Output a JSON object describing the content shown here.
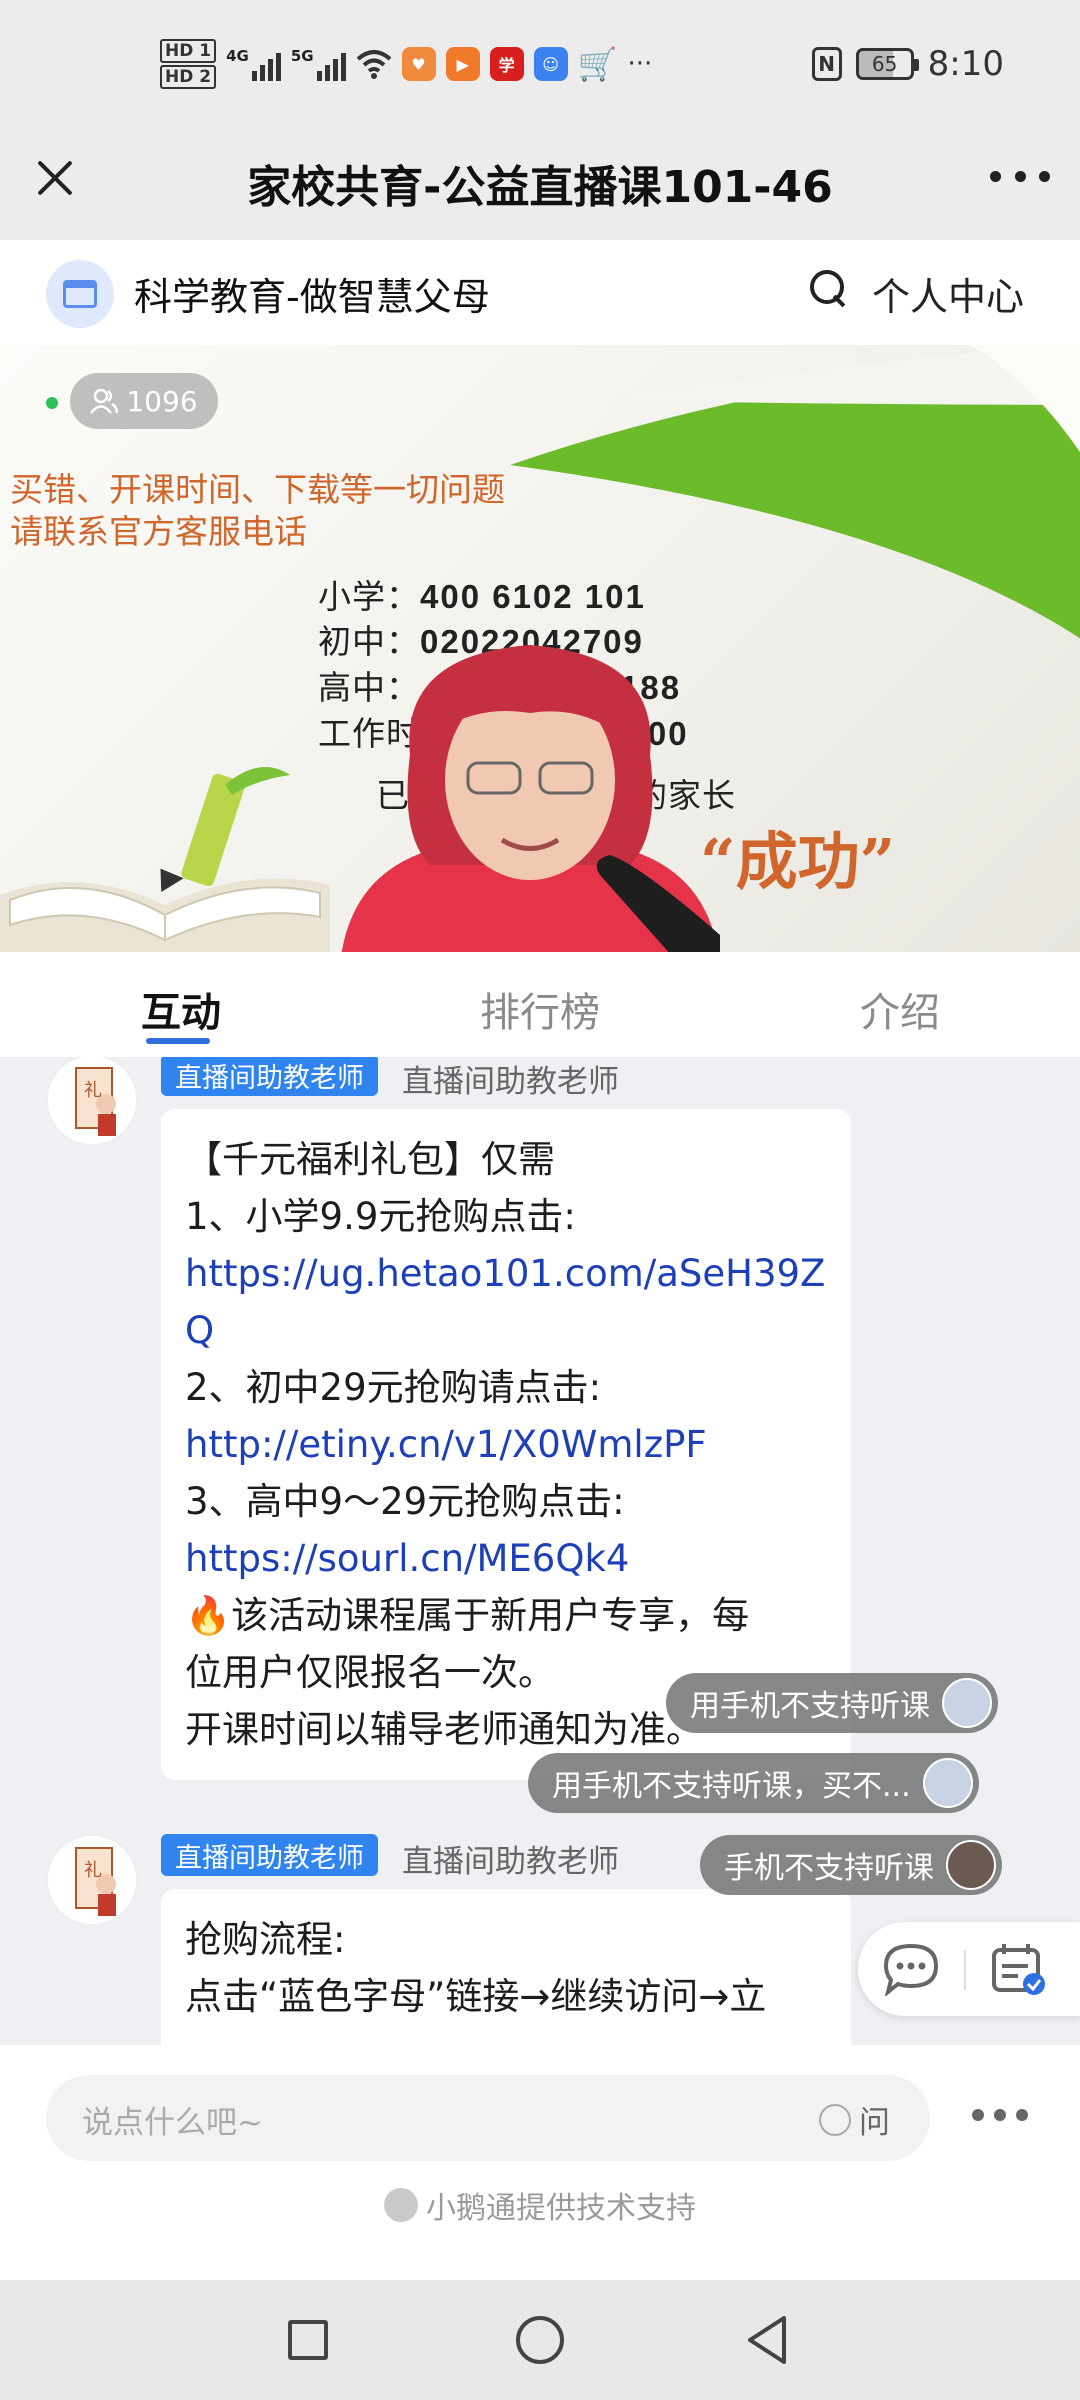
{
  "status_bar": {
    "hd1": "HD 1",
    "hd2": "HD 2",
    "net1": "4G",
    "net2": "5G",
    "more": "···",
    "nfc": "N",
    "battery": "65",
    "time": "8:10"
  },
  "titlebar": {
    "title": "家校共育-公益直播课101-46"
  },
  "shop": {
    "name": "科学教育-做智慧父母",
    "personal_center": "个人中心"
  },
  "video": {
    "viewers": "1096",
    "banner_line1": "买错、开课时间、下载等一切问题",
    "banner_line2": "请联系官方客服电话",
    "primary_label": "小学：",
    "primary_phone": "400 6102 101",
    "middle_label": "初中：",
    "middle_phone": "02022042709",
    "high_label": "高中：",
    "high_phone": "188",
    "hours_label": "工作时",
    "hours_value": "- 18:00",
    "parents_line_a": "已经",
    "parents_line_b": "的家长",
    "success_text": "“成功”"
  },
  "tabs": [
    {
      "label": "互动"
    },
    {
      "label": "排行榜"
    },
    {
      "label": "介绍"
    }
  ],
  "messages": [
    {
      "badge": "直播间助教老师",
      "sender": "直播间助教老师",
      "lines": [
        "【千元福利礼包】仅需",
        "1、小学9.9元抢购点击:",
        "https://ug.hetao101.com/aSeH39Z",
        "Q",
        "2、初中29元抢购请点击:",
        "http://etiny.cn/v1/X0WmlzPF",
        "3、高中9～29元抢购点击:",
        "https://sourl.cn/ME6Qk4",
        "🔥该活动课程属于新用户专享，每",
        "位用户仅限报名一次。",
        "开课时间以辅导老师通知为准。"
      ]
    },
    {
      "badge": "直播间助教老师",
      "sender": "直播间助教老师",
      "lines": [
        "抢购流程:",
        "点击“蓝色字母”链接→继续访问→立"
      ]
    }
  ],
  "floating_comments": [
    {
      "text": "用手机不支持听课"
    },
    {
      "text": "用手机不支持听课，买不..."
    },
    {
      "text": "手机不支持听课"
    }
  ],
  "input_bar": {
    "placeholder": "说点什么吧~",
    "ask_label": "问",
    "powered_by": "小鹅通提供技术支持"
  },
  "icons": {
    "close": "close-icon",
    "more": "more-icon",
    "search": "search-icon",
    "store": "store-icon",
    "viewers": "people-icon",
    "comment": "comment-icon",
    "calendar": "calendar-check-icon"
  },
  "colors": {
    "accent": "#2f6fe0",
    "badge": "#2f84f0",
    "link": "#1d3fb8",
    "banner_orange": "#d0662b",
    "green": "#69b82a"
  }
}
